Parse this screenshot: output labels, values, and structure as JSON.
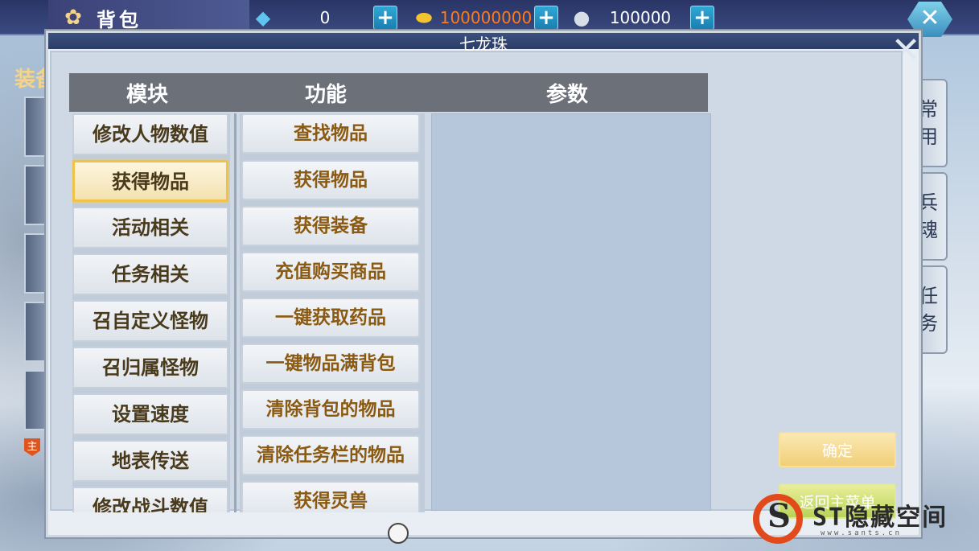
{
  "topbar": {
    "bag_label": "背包",
    "flower_icon": "flower-icon",
    "diamond_value": "0",
    "gold_value": "100000000",
    "silver_value": "100000",
    "plus_symbol": "+",
    "close_symbol": "✕"
  },
  "background": {
    "equip_label": "装备",
    "main_badge": "主",
    "side_tabs": [
      {
        "text": "常用"
      },
      {
        "text": "兵魂"
      },
      {
        "text": "任务"
      }
    ]
  },
  "dialog": {
    "title": "七龙珠",
    "close_symbol": "✕",
    "headers": {
      "module": "模块",
      "function": "功能",
      "params": "参数"
    },
    "modules": [
      {
        "label": "修改人物数值"
      },
      {
        "label": "获得物品",
        "selected": true
      },
      {
        "label": "活动相关"
      },
      {
        "label": "任务相关"
      },
      {
        "label": "召自定义怪物"
      },
      {
        "label": "召归属怪物"
      },
      {
        "label": "设置速度"
      },
      {
        "label": "地表传送"
      },
      {
        "label": "修改战斗数值"
      }
    ],
    "functions": [
      {
        "label": "查找物品"
      },
      {
        "label": "获得物品"
      },
      {
        "label": "获得装备"
      },
      {
        "label": "充值购买商品"
      },
      {
        "label": "一键获取药品"
      },
      {
        "label": "一键物品满背包"
      },
      {
        "label": "清除背包的物品"
      },
      {
        "label": "清除任务栏的物品"
      },
      {
        "label": "获得灵兽"
      }
    ],
    "confirm_label": "确定",
    "back_label": "返回主菜单"
  },
  "watermark": {
    "logo_letter": "S",
    "text": "ST隐藏空间",
    "url": "www.sants.cn"
  },
  "colors": {
    "selected_border": "#f1c24a",
    "function_text": "#8a5a12",
    "module_text": "#4a3a1c",
    "header_bg": "#6b7079",
    "gold_value": "#ff7a1a"
  }
}
